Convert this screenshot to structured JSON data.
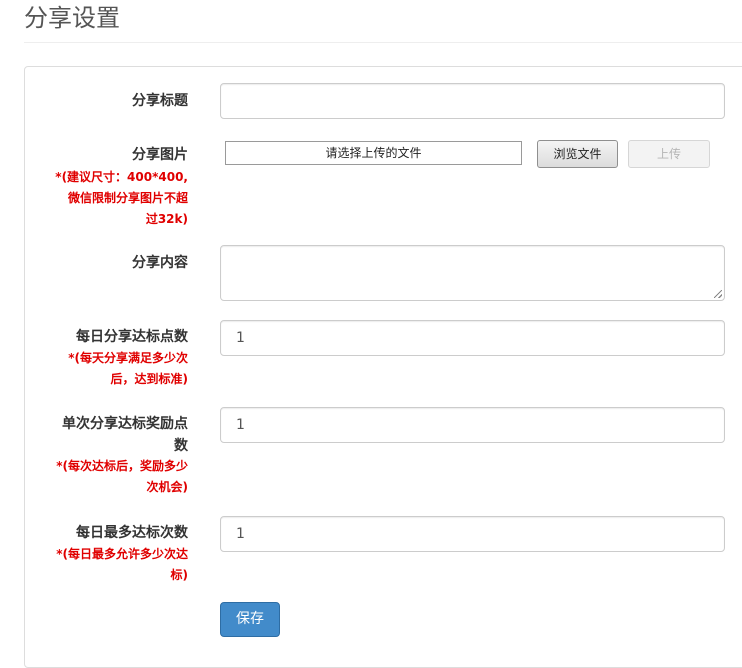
{
  "page": {
    "title": "分享设置"
  },
  "form": {
    "share_title": {
      "label": "分享标题",
      "value": ""
    },
    "share_image": {
      "label": "分享图片",
      "hint_lines": [
        "*(建议尺寸：400*400,",
        "微信限制分享图片不超",
        "过32k)"
      ],
      "file_placeholder": "请选择上传的文件",
      "browse_label": "浏览文件",
      "upload_label": "上传"
    },
    "share_content": {
      "label": "分享内容",
      "value": ""
    },
    "daily_share_target": {
      "label": "每日分享达标点数",
      "hint_lines": [
        "*(每天分享满足多少次",
        "后，达到标准)"
      ],
      "value": "1"
    },
    "single_reward_points": {
      "label_lines": [
        "单次分享达标奖励点",
        "数"
      ],
      "hint_lines": [
        "*(每次达标后，奖励多少",
        "次机会)"
      ],
      "value": "1"
    },
    "daily_max_times": {
      "label": "每日最多达标次数",
      "hint_lines": [
        "*(每日最多允许多少次达",
        "标)"
      ],
      "value": "1"
    },
    "save_label": "保存"
  },
  "colors": {
    "primary_button": "#428bca",
    "hint_red": "#e00000"
  }
}
